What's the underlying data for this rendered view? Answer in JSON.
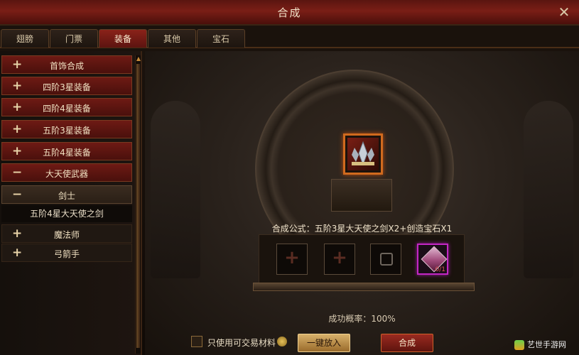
{
  "window": {
    "title": "合成"
  },
  "tabs": [
    {
      "label": "翅膀",
      "active": false
    },
    {
      "label": "门票",
      "active": false
    },
    {
      "label": "装备",
      "active": true
    },
    {
      "label": "其他",
      "active": false
    },
    {
      "label": "宝石",
      "active": false
    }
  ],
  "sidebar": {
    "items": [
      {
        "label": "首饰合成",
        "sign": "+"
      },
      {
        "label": "四阶3星装备",
        "sign": "+"
      },
      {
        "label": "四阶4星装备",
        "sign": "+"
      },
      {
        "label": "五阶3星装备",
        "sign": "+"
      },
      {
        "label": "五阶4星装备",
        "sign": "+"
      },
      {
        "label": "大天使武器",
        "sign": "−"
      },
      {
        "label": "剑士",
        "sign": "−"
      },
      {
        "label": "五阶4星大天使之剑"
      },
      {
        "label": "魔法师",
        "sign": "+"
      },
      {
        "label": "弓箭手",
        "sign": "+"
      }
    ]
  },
  "main": {
    "formula": "合成公式：五阶3星大天使之剑X2+创造宝石X1",
    "success_rate_label": "成功概率：",
    "success_rate_value": "100%",
    "gem_count": "0/1",
    "tradable_only_label": "只使用可交易材料",
    "one_click_label": "一键放入",
    "combine_label": "合成"
  },
  "watermark": {
    "text": "艺世手游网"
  },
  "colors": {
    "accent": "#8a2219",
    "gem_border": "#c327c4",
    "item_border": "#d06a1e"
  }
}
